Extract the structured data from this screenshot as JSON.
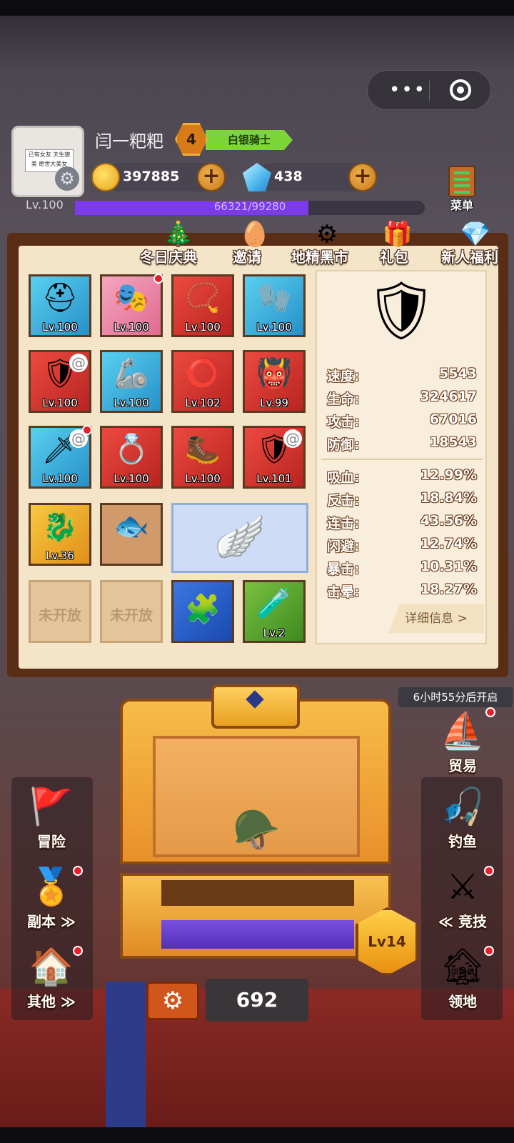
{
  "player": {
    "name": "闫一粑粑",
    "rank_num": "4",
    "rank_title": "白银骑士",
    "avatar_note": "已有女友\n天生貌美 绝世大美女",
    "level": "Lv.100",
    "xp_text": "66321/99280",
    "xp_progress": 0.668
  },
  "resources": {
    "gold": "397885",
    "gems": "438"
  },
  "menu_label": "菜单",
  "events": [
    {
      "label": "冬日庆典",
      "icon": "🎄"
    },
    {
      "label": "邀请",
      "icon": "🥚"
    },
    {
      "label": "地精黑市",
      "icon": "⚙"
    },
    {
      "label": "礼包",
      "icon": "🎁"
    },
    {
      "label": "新人福利",
      "icon": "💎"
    }
  ],
  "equipment": [
    {
      "slot": "helmet",
      "level": "Lv.100",
      "color": "blue",
      "icon": "⛑"
    },
    {
      "slot": "mask",
      "level": "Lv.100",
      "color": "pink",
      "icon": "🎭"
    },
    {
      "slot": "necklace",
      "level": "Lv.100",
      "color": "red",
      "icon": "📿"
    },
    {
      "slot": "gauntlet",
      "level": "Lv.100",
      "color": "blue",
      "icon": "🧤"
    },
    {
      "slot": "armor",
      "level": "Lv.100",
      "color": "red",
      "icon": "🛡"
    },
    {
      "slot": "bracer",
      "level": "Lv.100",
      "color": "blue",
      "icon": "🦾"
    },
    {
      "slot": "belt",
      "level": "Lv.102",
      "color": "red",
      "icon": "⭕"
    },
    {
      "slot": "shoulder",
      "level": "Lv.99",
      "color": "red",
      "icon": "👹"
    },
    {
      "slot": "sword",
      "level": "Lv.100",
      "color": "blue",
      "icon": "🗡"
    },
    {
      "slot": "ring",
      "level": "Lv.100",
      "color": "red",
      "icon": "💍"
    },
    {
      "slot": "boots",
      "level": "Lv.100",
      "color": "red",
      "icon": "🥾"
    },
    {
      "slot": "shield",
      "level": "Lv.101",
      "color": "red",
      "icon": "🛡"
    },
    {
      "slot": "pet",
      "level": "Lv.36",
      "color": "yellow",
      "icon": "🐉"
    },
    {
      "slot": "fish",
      "level": "",
      "color": "brown",
      "icon": "🐟"
    }
  ],
  "wings_icon": "🪽",
  "locked_label": "未开放",
  "amulet": {
    "icon": "🧩"
  },
  "potion": {
    "level": "Lv.2",
    "icon": "🧪"
  },
  "hero_icon": "🛡",
  "stats_main": [
    {
      "label": "速度:",
      "value": "5543"
    },
    {
      "label": "生命:",
      "value": "324617"
    },
    {
      "label": "攻击:",
      "value": "67016"
    },
    {
      "label": "防御:",
      "value": "18543"
    }
  ],
  "stats_secondary": [
    {
      "label": "吸血:",
      "value": "12.99%"
    },
    {
      "label": "反击:",
      "value": "18.84%"
    },
    {
      "label": "连击:",
      "value": "43.56%"
    },
    {
      "label": "闪避:",
      "value": "12.74%"
    },
    {
      "label": "暴击:",
      "value": "10.31%"
    },
    {
      "label": "击晕:",
      "value": "18.27%"
    }
  ],
  "detail_button": "详细信息 >",
  "trade": {
    "timer": "6小时55分后开启",
    "label": "贸易",
    "icon": "⛵"
  },
  "left_buttons": [
    {
      "label": "冒险",
      "icon": "🚩"
    },
    {
      "label": "副本 ≫",
      "icon": "🏅"
    },
    {
      "label": "其他 ≫",
      "icon": "🏠"
    }
  ],
  "right_buttons": [
    {
      "label": "钓鱼",
      "icon": "🎣"
    },
    {
      "label": "≪ 竞技",
      "icon": "⚔"
    },
    {
      "label": "领地",
      "icon": "🏚"
    }
  ],
  "chest": {
    "level": "Lv14",
    "count": "692",
    "item_icon": "🪖"
  },
  "settings_icon": "⚙",
  "colors": {
    "xp_fill": "#7c3ae8",
    "rank_green": "#7cd63a",
    "red_dot": "#e8202a"
  }
}
